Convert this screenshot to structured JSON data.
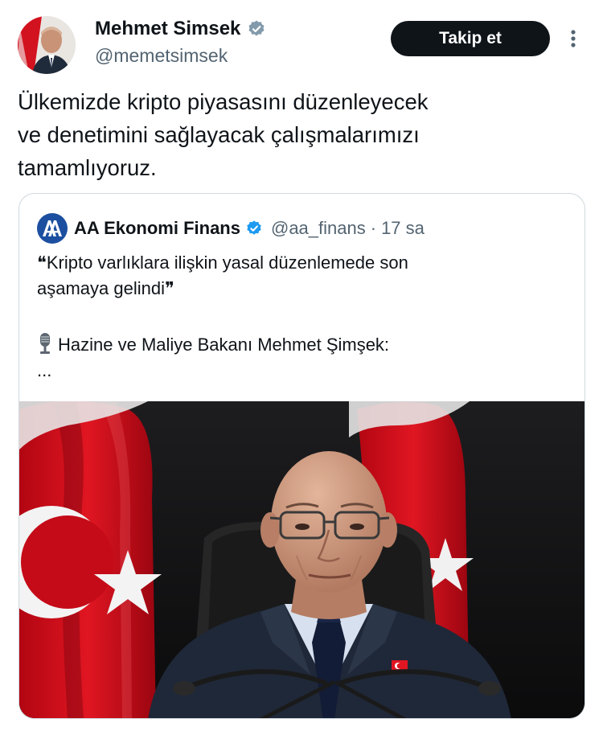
{
  "author": {
    "name": "Mehmet Simsek",
    "handle": "@memetsimsek",
    "verified_icon": "verified-badge-icon"
  },
  "actions": {
    "follow_label": "Takip et",
    "more_icon": "more-vertical-icon"
  },
  "tweet": {
    "lines": [
      "Ülkemizde kripto piyasasını düzenleyecek",
      "ve denetimini sağlayacak çalışmalarımızı",
      "tamamlıyoruz."
    ]
  },
  "quote": {
    "name": "AA Ekonomi Finans",
    "handle": "@aa_finans",
    "separator": "·",
    "time": "17 sa",
    "avatar_text": "AA",
    "lines": [
      "❝Kripto varlıklara ilişkin yasal düzenlemede son",
      "aşamaya gelindi❞"
    ],
    "speaker_line": "Hazine ve Maliye Bakanı Mehmet Şimşek:",
    "ellipsis": "..."
  },
  "colors": {
    "brand_blue": "#1d9bf0",
    "text_primary": "#0f1419",
    "text_secondary": "#536471",
    "flag_red": "#e30a17",
    "border": "#cfd9de"
  }
}
